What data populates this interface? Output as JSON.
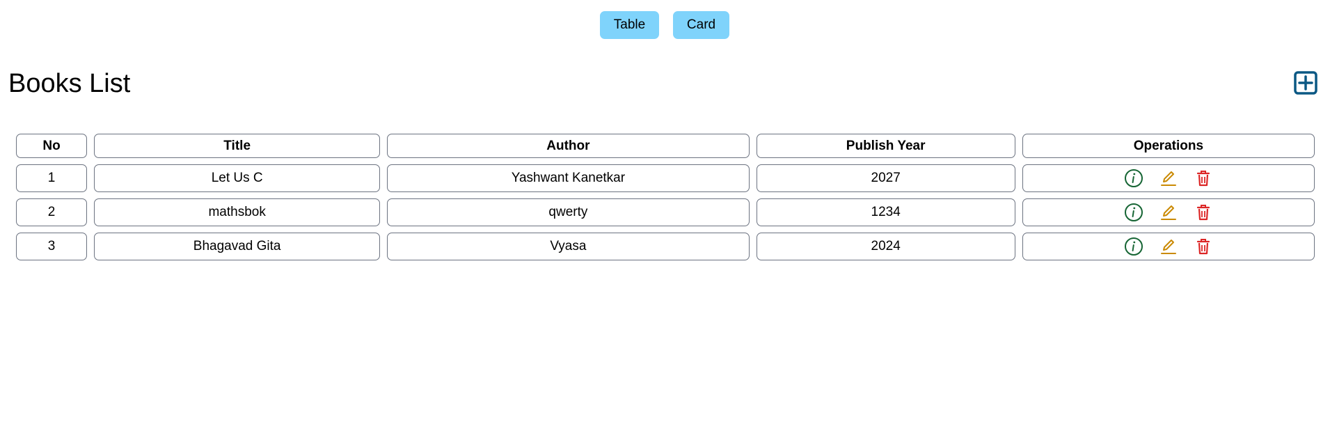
{
  "view_toggle": {
    "table_label": "Table",
    "card_label": "Card"
  },
  "page": {
    "title": "Books List",
    "add_icon": "plus-square-icon"
  },
  "table": {
    "headers": [
      "No",
      "Title",
      "Author",
      "Publish Year",
      "Operations"
    ],
    "rows": [
      {
        "no": "1",
        "title": "Let Us C",
        "author": "Yashwant Kanetkar",
        "year": "2027"
      },
      {
        "no": "2",
        "title": "mathsbok",
        "author": "qwerty",
        "year": "1234"
      },
      {
        "no": "3",
        "title": "Bhagavad Gita",
        "author": "Vyasa",
        "year": "2024"
      }
    ],
    "operation_icons": [
      "info-icon",
      "edit-icon",
      "delete-icon"
    ]
  },
  "colors": {
    "toggle_button": "#7fd3fb",
    "add_icon": "#0b5884",
    "info_icon": "#166534",
    "edit_icon": "#ca8a04",
    "delete_icon": "#dc2626",
    "cell_border": "#6b7280"
  }
}
